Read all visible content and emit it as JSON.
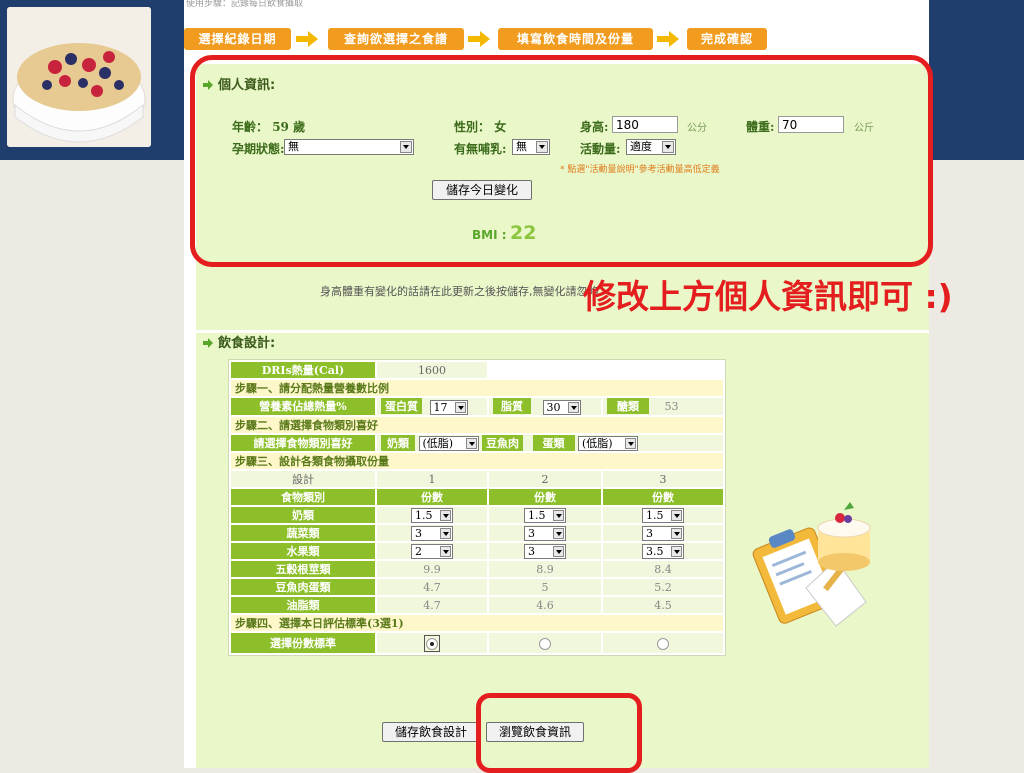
{
  "header": {
    "crumb_text": "使用步驟：記錄每日飲食攝取"
  },
  "steps": [
    "選擇紀錄日期",
    "查詢欲選擇之食譜",
    "填寫飲食時間及份量",
    "完成確認"
  ],
  "personal": {
    "title": "個人資訊:",
    "age_label": "年齡：",
    "age_value": "59 歲",
    "gender_label": "性別：",
    "gender_value": "女",
    "height_label": "身高:",
    "height_value": "180",
    "height_unit": "公分",
    "weight_label": "體重:",
    "weight_value": "70",
    "weight_unit": "公斤",
    "pregnancy_label": "孕期狀態:",
    "pregnancy_value": "無",
    "nursing_label": "有無哺乳:",
    "nursing_value": "無",
    "activity_label": "活動量:",
    "activity_value": "適度",
    "activity_note": "* 點選\"活動量說明\"參考活動量高低定義",
    "save_button": "儲存今日變化",
    "bmi_label": "BMI :",
    "bmi_value": "22",
    "update_note": "身高體重有變化的話請在此更新之後按儲存,無變化請忽略"
  },
  "callout_text": "修改上方個人資訊即可 :)",
  "diet": {
    "title": "飲食設計:",
    "dris_label": "DRIs熱量(Cal)",
    "dris_value": "1600",
    "step1": "步驟一、請分配熱量營養數比例",
    "ratio_label": "營養素佔總熱量%",
    "protein_label": "蛋白質",
    "protein_value": "17",
    "fat_label": "脂質",
    "fat_value": "30",
    "carb_label": "醣類",
    "carb_value": "53",
    "step2": "步驟二、請選擇食物類別喜好",
    "pref_label": "請選擇食物類別喜好",
    "milk_label": "奶類",
    "milk_pref": "(低脂)",
    "meat_label": "豆魚肉",
    "egg_label": "蛋類",
    "egg_pref": "(低脂)",
    "step3": "步驟三、設計各類食物攝取份量",
    "design_label": "設計",
    "design_cols": [
      "1",
      "2",
      "3"
    ],
    "category_label": "食物類別",
    "portion_label": "份數",
    "rows": [
      {
        "name": "奶類",
        "values": [
          "1.5",
          "1.5",
          "1.5"
        ],
        "select": true
      },
      {
        "name": "蔬菜類",
        "values": [
          "3",
          "3",
          "3"
        ],
        "select": true
      },
      {
        "name": "水果類",
        "values": [
          "2",
          "3",
          "3.5"
        ],
        "select": true
      },
      {
        "name": "五穀根莖類",
        "values": [
          "9.9",
          "8.9",
          "8.4"
        ],
        "select": false
      },
      {
        "name": "豆魚肉蛋類",
        "values": [
          "4.7",
          "5",
          "5.2"
        ],
        "select": false
      },
      {
        "name": "油脂類",
        "values": [
          "4.7",
          "4.6",
          "4.5"
        ],
        "select": false
      }
    ],
    "step4": "步驟四、選擇本日評估標準(3選1)",
    "choose_label": "選擇份數標準",
    "selected_standard": 1
  },
  "buttons": {
    "save_design": "儲存飲食設計",
    "browse_info": "瀏覽飲食資訊"
  },
  "colors": {
    "navy": "#1f3e6e",
    "panel_green": "#e9f7c9",
    "header_green": "#8dbf2a",
    "step_orange": "#f29c1f",
    "callout_red": "#e41e1e"
  }
}
